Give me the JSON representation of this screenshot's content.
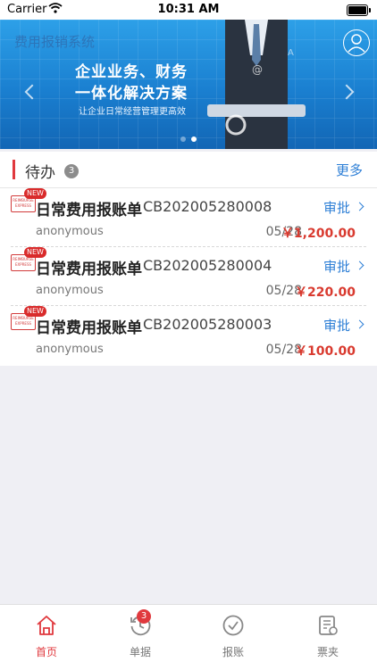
{
  "status_bar": {
    "carrier": "Carrier",
    "time": "10:31 AM"
  },
  "banner": {
    "app_title": "费用报销系统",
    "slogan_line1": "企业业务、财务",
    "slogan_line2": "一体化解决方案",
    "slogan_line3": "让企业日常经营管理更高效",
    "slide_count": 2,
    "active_slide": 2
  },
  "todo": {
    "title": "待办",
    "count": "3",
    "more_label": "更多",
    "items": [
      {
        "new": "NEW",
        "name": "日常费用报账单",
        "code": "CB202005280008",
        "action": "审批",
        "user": "anonymous",
        "date": "05/28",
        "amount": "￥1,200.00"
      },
      {
        "new": "NEW",
        "name": "日常费用报账单",
        "code": "CB202005280004",
        "action": "审批",
        "user": "anonymous",
        "date": "05/28",
        "amount": "￥220.00"
      },
      {
        "new": "NEW",
        "name": "日常费用报账单",
        "code": "CB202005280003",
        "action": "审批",
        "user": "anonymous",
        "date": "05/28",
        "amount": "￥100.00"
      }
    ],
    "stamp_text": "REIMBURSE EXPRESS"
  },
  "tabbar": {
    "tabs": [
      {
        "label": "首页",
        "icon": "home-icon",
        "active": true
      },
      {
        "label": "单据",
        "icon": "history-icon",
        "badge": "3"
      },
      {
        "label": "报账",
        "icon": "check-circle-icon"
      },
      {
        "label": "票夹",
        "icon": "ticket-folder-icon"
      }
    ]
  },
  "colors": {
    "accent_red": "#e0393e",
    "link_blue": "#2e7fd6",
    "banner_blue": "#1a7fd0"
  }
}
